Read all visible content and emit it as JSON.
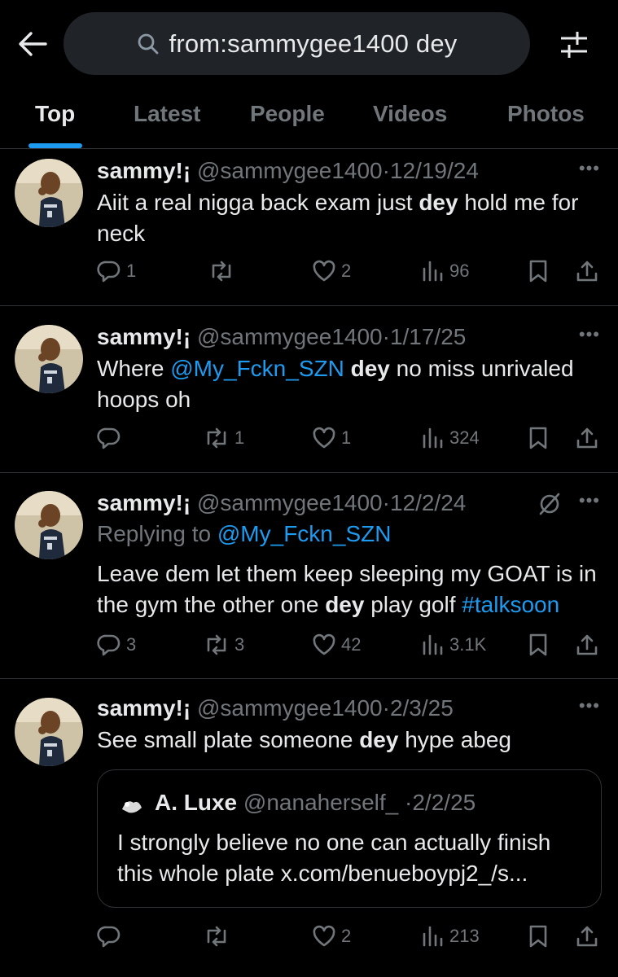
{
  "search": {
    "query": "from:sammygee1400 dey"
  },
  "tabs": [
    "Top",
    "Latest",
    "People",
    "Videos",
    "Photos"
  ],
  "tweets": [
    {
      "name": "sammy!¡",
      "handle": "@sammygee1400",
      "date": "12/19/24",
      "text1": "Aiit a real nigga back exam just ",
      "bold1": "dey",
      "text2": " hold me for neck",
      "replies": "1",
      "retweets": "",
      "likes": "2",
      "views": "96"
    },
    {
      "name": "sammy!¡",
      "handle": "@sammygee1400",
      "date": "1/17/25",
      "text1": "Where ",
      "mention": "@My_Fckn_SZN",
      "text2": " ",
      "bold1": "dey",
      "text3": " no miss unrivaled hoops oh",
      "replies": "",
      "retweets": "1",
      "likes": "1",
      "views": "324"
    },
    {
      "name": "sammy!¡",
      "handle": "@sammygee1400",
      "date": "12/2/24",
      "replying_label": "Replying to ",
      "replying_to": "@My_Fckn_SZN",
      "text1": "Leave dem let them keep sleeping my GOAT is in the gym the other one ",
      "bold1": "dey",
      "text2": " play golf ",
      "hashtag": "#talksoon",
      "replies": "3",
      "retweets": "3",
      "likes": "42",
      "views": "3.1K"
    },
    {
      "name": "sammy!¡",
      "handle": "@sammygee1400",
      "date": "2/3/25",
      "text1": "See small plate someone ",
      "bold1": "dey",
      "text2": " hype abeg",
      "quote": {
        "name": "A. Luxe",
        "handle": "@nanaherself_",
        "date": "2/2/25",
        "text": "I strongly believe no one can actually finish this whole plate x.com/benueboypj2_/s..."
      },
      "replies": "",
      "retweets": "",
      "likes": "2",
      "views": "213"
    }
  ],
  "sep": "·",
  "more": "•••"
}
